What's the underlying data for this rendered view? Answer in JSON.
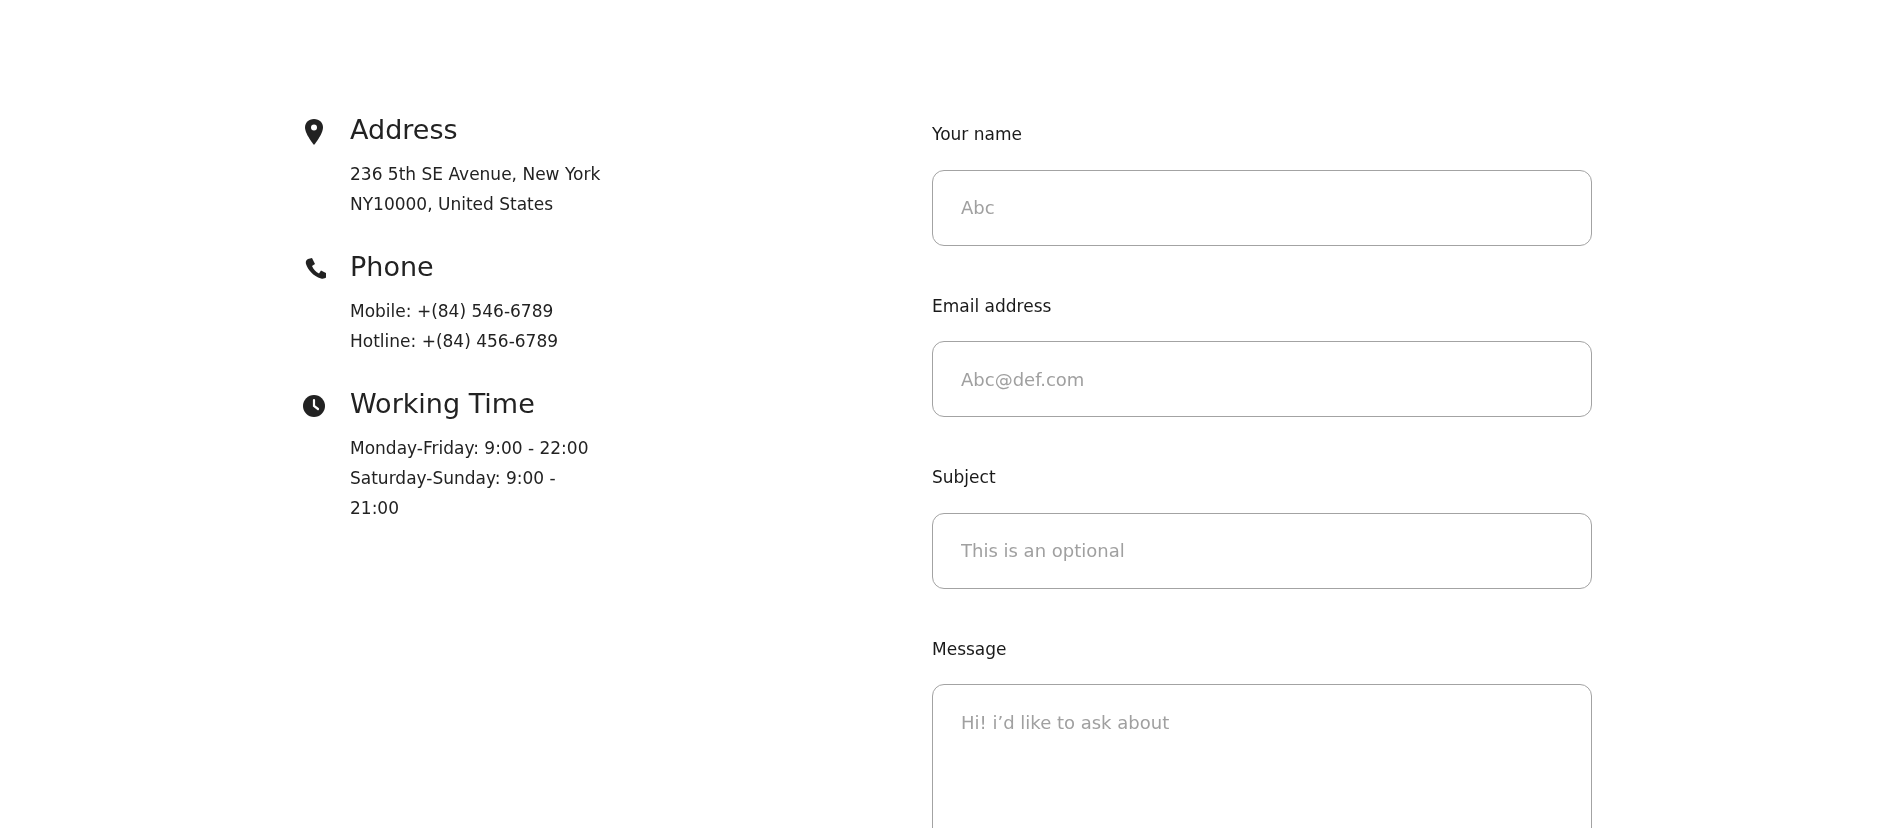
{
  "contact_info": [
    {
      "kind": "location",
      "title": "Address",
      "lines": [
        "236 5th SE Avenue, New York NY10000, United States"
      ]
    },
    {
      "kind": "phone",
      "title": "Phone",
      "lines": [
        "Mobile: +(84) 546-6789",
        "Hotline: +(84) 456-6789"
      ]
    },
    {
      "kind": "clock",
      "title": "Working Time",
      "lines": [
        "Monday-Friday: 9:00 - 22:00",
        "Saturday-Sunday: 9:00 - 21:00"
      ]
    }
  ],
  "form": {
    "fields": [
      {
        "kind": "input",
        "label": "Your name",
        "placeholder": "Abc"
      },
      {
        "kind": "input",
        "label": "Email address",
        "placeholder": "Abc@def.com"
      },
      {
        "kind": "input",
        "label": "Subject",
        "placeholder": "This is an optional"
      },
      {
        "kind": "textarea",
        "label": "Message",
        "placeholder": "Hi! i’d like to ask about"
      }
    ]
  }
}
